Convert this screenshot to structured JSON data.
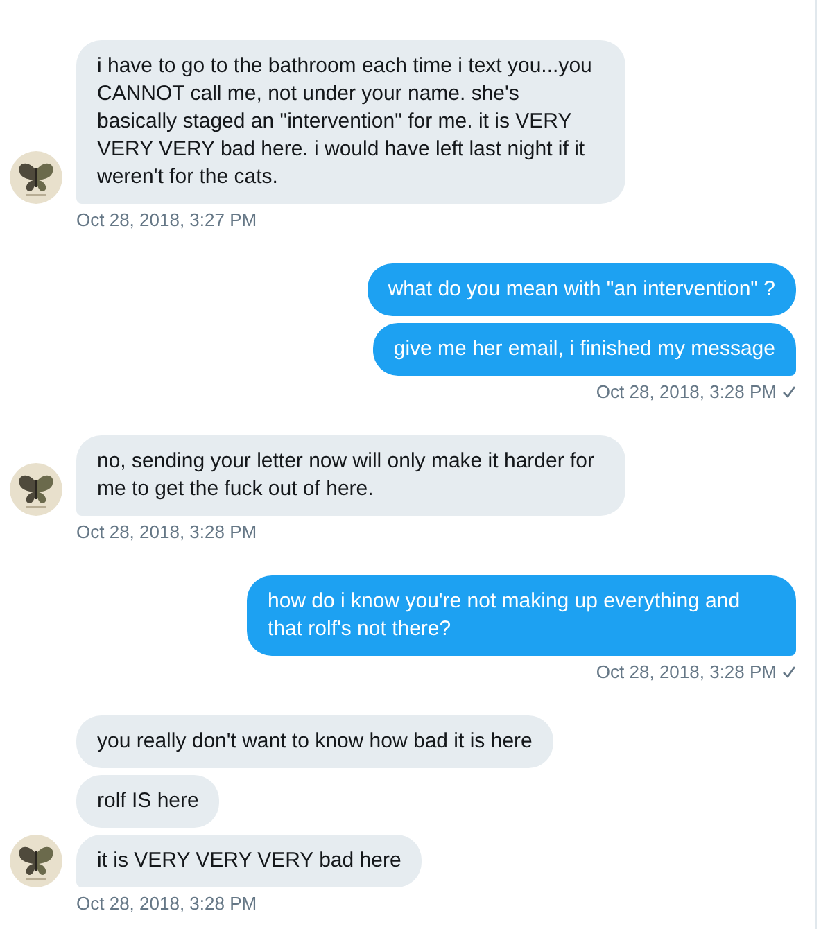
{
  "groups": [
    {
      "kind": "incoming",
      "messages": [
        "i have to go to the bathroom each time i text you...you CANNOT call me, not under your name. she's basically staged an \"intervention\" for me. it is VERY VERY VERY bad here. i would have left last night if it weren't for the cats."
      ],
      "time": "Oct 28, 2018, 3:27 PM"
    },
    {
      "kind": "outgoing",
      "messages": [
        "what do you mean with \"an intervention\" ?",
        "give me her email, i finished my message"
      ],
      "time": "Oct 28, 2018, 3:28 PM",
      "seen": true
    },
    {
      "kind": "incoming",
      "messages": [
        "no, sending your letter now will only make it harder for me to get the fuck out of here."
      ],
      "time": "Oct 28, 2018, 3:28 PM"
    },
    {
      "kind": "outgoing",
      "messages": [
        "how do i know you're not making up everything and that rolf's not there?"
      ],
      "time": "Oct 28, 2018, 3:28 PM",
      "seen": true
    },
    {
      "kind": "incoming",
      "messages": [
        "you really don't want to know how bad it is here",
        "rolf IS here",
        "it is VERY VERY VERY bad here"
      ],
      "time": "Oct 28, 2018, 3:28 PM"
    }
  ]
}
